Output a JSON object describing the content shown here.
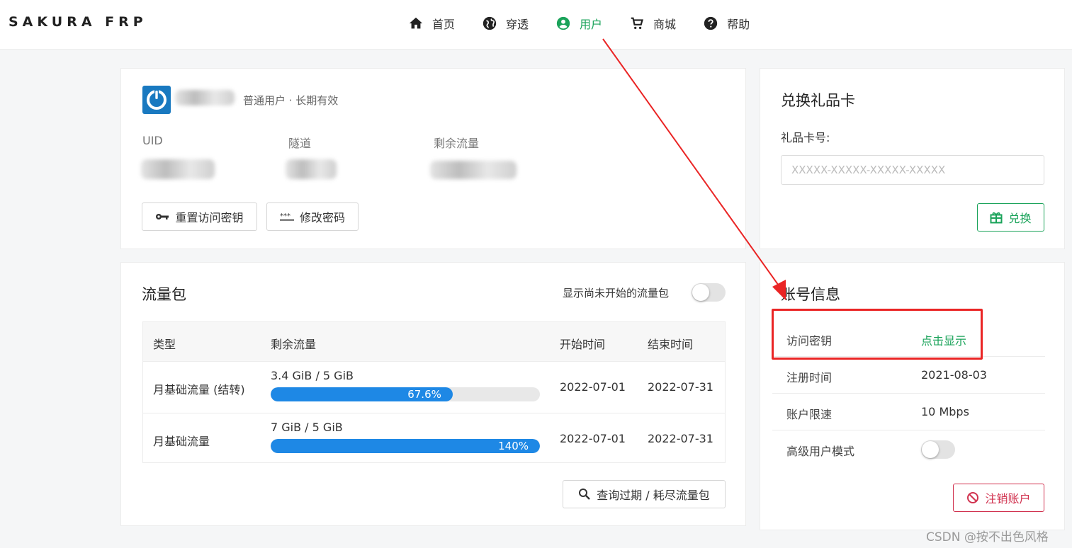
{
  "brand": "SAKURA FRP",
  "nav": {
    "home": "首页",
    "tunnel": "穿透",
    "user": "用户",
    "shop": "商城",
    "help": "帮助"
  },
  "profile": {
    "user_meta": "普通用户 · 长期有效",
    "uid_label": "UID",
    "tunnel_label": "隧道",
    "traffic_label": "剩余流量",
    "reset_key_button": "重置访问密钥",
    "change_password_button": "修改密码"
  },
  "traffic": {
    "title": "流量包",
    "toggle_label": "显示尚未开始的流量包",
    "toggle_on": false,
    "headers": [
      "类型",
      "剩余流量",
      "开始时间",
      "结束时间"
    ],
    "rows": [
      {
        "type": "月基础流量 (结转)",
        "amount": "3.4 GiB / 5 GiB",
        "percent_label": "67.6%",
        "percent": 67.6,
        "start": "2022-07-01",
        "end": "2022-07-31"
      },
      {
        "type": "月基础流量",
        "amount": "7 GiB / 5 GiB",
        "percent_label": "140%",
        "percent": 140,
        "start": "2022-07-01",
        "end": "2022-07-31"
      }
    ],
    "query_button": "查询过期 / 耗尽流量包"
  },
  "gift": {
    "title": "兑换礼品卡",
    "field_label": "礼品卡号:",
    "placeholder": "XXXXX-XXXXX-XXXXX-XXXXX",
    "redeem_button": "兑换"
  },
  "account": {
    "title": "账号信息",
    "access_key_label": "访问密钥",
    "access_key_action": "点击显示",
    "register_label": "注册时间",
    "register_value": "2021-08-03",
    "speed_label": "账户限速",
    "speed_value": "10 Mbps",
    "advanced_label": "高级用户模式",
    "advanced_on": false,
    "delete_button": "注销账户"
  },
  "watermark": "CSDN @按不出色风格",
  "colors": {
    "accent": "#1aa35a",
    "progress": "#1e88e5",
    "danger": "#d1324f",
    "annotation": "#ea2525"
  }
}
